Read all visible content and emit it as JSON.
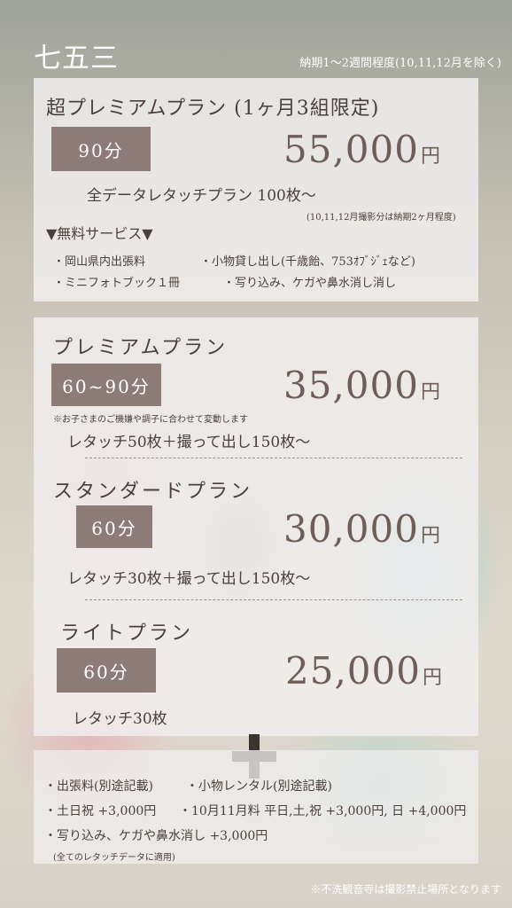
{
  "title": "七五三",
  "delivery_note": "納期1〜2週間程度(10,11,12月を除く)",
  "premium_plus": {
    "name": "超プレミアムプラン (1ヶ月3組限定)",
    "duration": "90分",
    "price": "55,000",
    "yen": "円",
    "desc": "全データレタッチプラン 100枚〜",
    "note": "(10,11,12月撮影分は納期2ヶ月程度)",
    "services_title": "▼無料サービス▼",
    "services": [
      "・岡山県内出張料",
      "・小物貸し出し(千歳飴、753ｵﾌﾞｼﾞｪなど)",
      "・ミニフォトブック１冊",
      "・写り込み、ケガや鼻水消し消し"
    ]
  },
  "premium": {
    "name": "プレミアムプラン",
    "duration": "60~90分",
    "price": "35,000",
    "yen": "円",
    "note": "※お子さまのご機嫌や調子に合わせて変動します",
    "desc": "レタッチ50枚＋撮って出し150枚〜"
  },
  "standard": {
    "name": "スタンダードプラン",
    "duration": "60分",
    "price": "30,000",
    "yen": "円",
    "desc": "レタッチ30枚＋撮って出し150枚〜"
  },
  "light": {
    "name": "ライトプラン",
    "duration": "60分",
    "price": "25,000",
    "yen": "円",
    "desc": "レタッチ30枚"
  },
  "extras": {
    "items": [
      "・出張料(別途記載)",
      "・小物レンタル(別途記載)",
      "・土日祝 +3,000円",
      "・10月11月料 平日,土,祝 +3,000円, 日 +4,000円",
      "・写り込み、ケガや鼻水消し +3,000円"
    ],
    "note": "(全てのレタッチデータに適用)"
  },
  "footer_note": "※不洗観音寺は撮影禁止場所となります",
  "colors": {
    "duration_badge": "#8d7b77",
    "price": "#6e5d58",
    "panel": "#f0eeee"
  }
}
